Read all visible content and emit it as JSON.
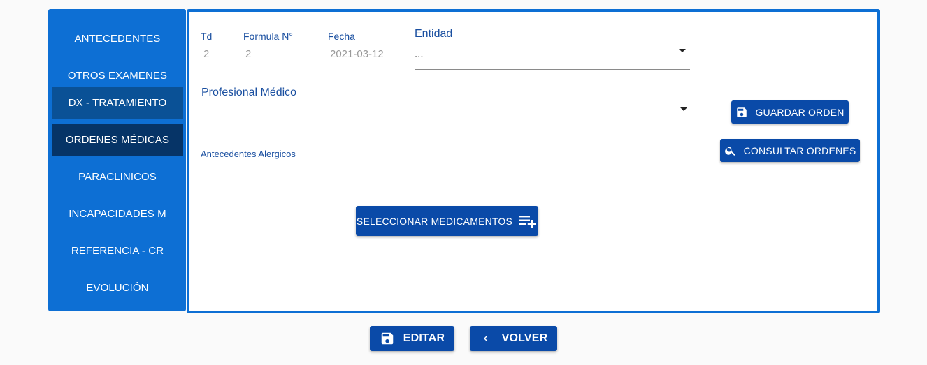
{
  "sidebar": {
    "items": [
      {
        "label": "ANTECEDENTES"
      },
      {
        "label": "OTROS EXAMENES"
      },
      {
        "label": "DX - TRATAMIENTO"
      },
      {
        "label": "ORDENES MÉDICAS"
      },
      {
        "label": "PARACLINICOS"
      },
      {
        "label": "INCAPACIDADES M"
      },
      {
        "label": "REFERENCIA - CR"
      },
      {
        "label": "EVOLUCIÓN"
      }
    ]
  },
  "form": {
    "td": {
      "label": "Td",
      "value": "2"
    },
    "formula": {
      "label": "Formula N°",
      "value": "2"
    },
    "fecha": {
      "label": "Fecha",
      "value": "2021-03-12"
    },
    "entidad": {
      "label": "Entidad",
      "value": "..."
    },
    "profesional": {
      "label": "Profesional Médico",
      "value": ""
    },
    "antecedentes": {
      "label": "Antecedentes Alergicos",
      "value": ""
    }
  },
  "actions": {
    "seleccionar": "SELECCIONAR MEDICAMENTOS",
    "guardar": "GUARDAR ORDEN",
    "consultar": "CONSULTAR ORDENES",
    "editar": "EDITAR",
    "volver": "VOLVER"
  },
  "icons": {
    "save": "save-icon",
    "search": "search-icon",
    "playlist_add": "playlist-add-icon",
    "chevron_left": "chevron-left-icon"
  },
  "colors": {
    "sidebar_bg": "#0d6fd4",
    "sidebar_active_dx": "#0a5196",
    "sidebar_active_ordenes": "#063467",
    "button_bg": "#0a4aa8",
    "label_color": "#1a4fa0"
  }
}
